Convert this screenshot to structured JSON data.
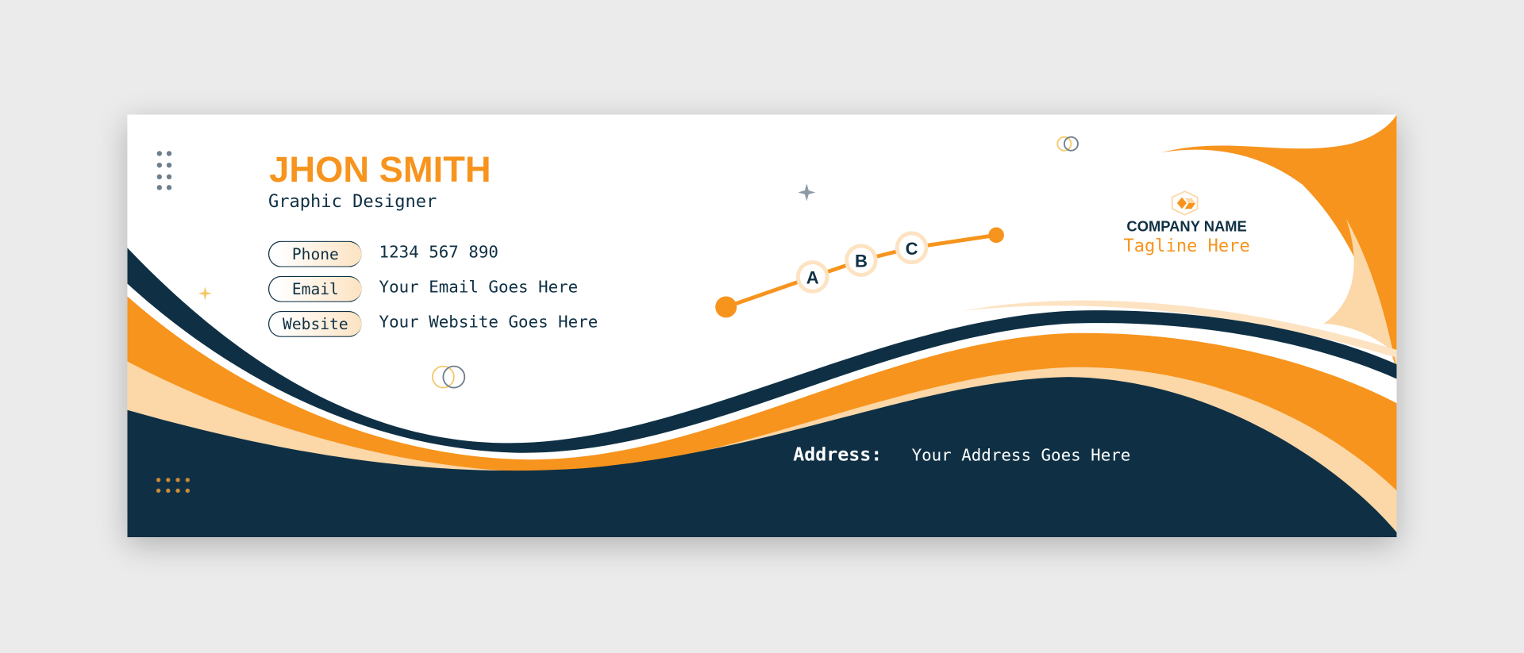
{
  "colors": {
    "orange": "#f7941d",
    "navy": "#0f3044",
    "peach": "#fcd7a8",
    "background": "#ebebeb"
  },
  "person": {
    "name": "JHON SMITH",
    "title": "Graphic Designer"
  },
  "contacts": [
    {
      "label": "Phone",
      "value": "1234 567 890"
    },
    {
      "label": "Email",
      "value": "Your Email Goes Here"
    },
    {
      "label": "Website",
      "value": "Your Website Goes Here"
    }
  ],
  "company": {
    "name": "COMPANY NAME",
    "tagline": "Tagline Here",
    "logo_icon": "hexagon-cube-logo"
  },
  "address": {
    "label": "Address:",
    "value": "Your Address Goes Here"
  },
  "timeline": {
    "points": [
      "A",
      "B",
      "C"
    ]
  }
}
